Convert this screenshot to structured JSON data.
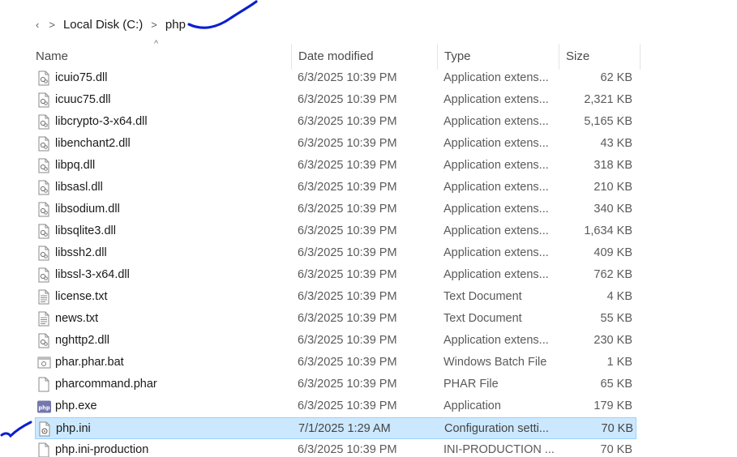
{
  "breadcrumb": {
    "chevron": ">",
    "items": [
      "Local Disk (C:)",
      "php"
    ]
  },
  "columns": {
    "name": "Name",
    "date": "Date modified",
    "type": "Type",
    "size": "Size",
    "sort_indicator": "^"
  },
  "files": [
    {
      "name": "icuio75.dll",
      "date": "6/3/2025 10:39 PM",
      "type": "Application extens...",
      "size": "62 KB",
      "icon": "dll-file-icon"
    },
    {
      "name": "icuuc75.dll",
      "date": "6/3/2025 10:39 PM",
      "type": "Application extens...",
      "size": "2,321 KB",
      "icon": "dll-file-icon"
    },
    {
      "name": "libcrypto-3-x64.dll",
      "date": "6/3/2025 10:39 PM",
      "type": "Application extens...",
      "size": "5,165 KB",
      "icon": "dll-file-icon"
    },
    {
      "name": "libenchant2.dll",
      "date": "6/3/2025 10:39 PM",
      "type": "Application extens...",
      "size": "43 KB",
      "icon": "dll-file-icon"
    },
    {
      "name": "libpq.dll",
      "date": "6/3/2025 10:39 PM",
      "type": "Application extens...",
      "size": "318 KB",
      "icon": "dll-file-icon"
    },
    {
      "name": "libsasl.dll",
      "date": "6/3/2025 10:39 PM",
      "type": "Application extens...",
      "size": "210 KB",
      "icon": "dll-file-icon"
    },
    {
      "name": "libsodium.dll",
      "date": "6/3/2025 10:39 PM",
      "type": "Application extens...",
      "size": "340 KB",
      "icon": "dll-file-icon"
    },
    {
      "name": "libsqlite3.dll",
      "date": "6/3/2025 10:39 PM",
      "type": "Application extens...",
      "size": "1,634 KB",
      "icon": "dll-file-icon"
    },
    {
      "name": "libssh2.dll",
      "date": "6/3/2025 10:39 PM",
      "type": "Application extens...",
      "size": "409 KB",
      "icon": "dll-file-icon"
    },
    {
      "name": "libssl-3-x64.dll",
      "date": "6/3/2025 10:39 PM",
      "type": "Application extens...",
      "size": "762 KB",
      "icon": "dll-file-icon"
    },
    {
      "name": "license.txt",
      "date": "6/3/2025 10:39 PM",
      "type": "Text Document",
      "size": "4 KB",
      "icon": "text-file-icon"
    },
    {
      "name": "news.txt",
      "date": "6/3/2025 10:39 PM",
      "type": "Text Document",
      "size": "55 KB",
      "icon": "text-file-icon"
    },
    {
      "name": "nghttp2.dll",
      "date": "6/3/2025 10:39 PM",
      "type": "Application extens...",
      "size": "230 KB",
      "icon": "dll-file-icon"
    },
    {
      "name": "phar.phar.bat",
      "date": "6/3/2025 10:39 PM",
      "type": "Windows Batch File",
      "size": "1 KB",
      "icon": "batch-file-icon"
    },
    {
      "name": "pharcommand.phar",
      "date": "6/3/2025 10:39 PM",
      "type": "PHAR File",
      "size": "65 KB",
      "icon": "blank-file-icon"
    },
    {
      "name": "php.exe",
      "date": "6/3/2025 10:39 PM",
      "type": "Application",
      "size": "179 KB",
      "icon": "php-exe-icon"
    },
    {
      "name": "php.ini",
      "date": "7/1/2025 1:29 AM",
      "type": "Configuration setti...",
      "size": "70 KB",
      "icon": "config-file-icon",
      "selected": true
    },
    {
      "name": "php.ini-production",
      "date": "6/3/2025 10:39 PM",
      "type": "INI-PRODUCTION ...",
      "size": "70 KB",
      "icon": "blank-file-icon"
    }
  ],
  "colors": {
    "selection_bg": "#cce8ff",
    "selection_border": "#99d1ff",
    "annotation_ink": "#0a1fd0",
    "php_icon": "#7377ad"
  }
}
